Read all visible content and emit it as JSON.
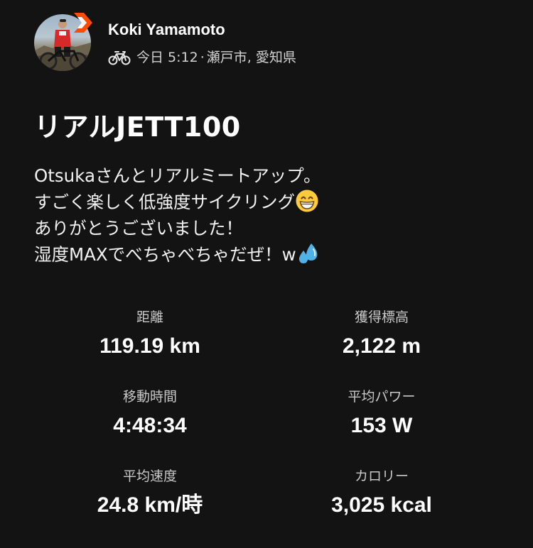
{
  "athlete": {
    "name": "Koki Yamamoto",
    "avatar_icon": "profile-photo",
    "badge_icon": "subscriber-chevron-icon"
  },
  "activity_meta": {
    "sport_icon": "bike-icon",
    "time": "今日 5:12",
    "separator": "·",
    "location": "瀬戸市, 愛知県"
  },
  "activity": {
    "title": "リアルJETT100",
    "description": [
      {
        "text": "Otsukaさんとリアルミートアップ。",
        "emoji": ""
      },
      {
        "text": "すごく楽しく低強度サイクリング",
        "emoji": "grinning-face-emoji"
      },
      {
        "text": "ありがとうございました！",
        "emoji": ""
      },
      {
        "text": "湿度MAXでべちゃべちゃだぜ！w",
        "emoji": "sweat-droplets-emoji"
      }
    ]
  },
  "stats": [
    {
      "label": "距離",
      "value": "119.19 km"
    },
    {
      "label": "獲得標高",
      "value": "2,122 m"
    },
    {
      "label": "移動時間",
      "value": "4:48:34"
    },
    {
      "label": "平均パワー",
      "value": "153 W"
    },
    {
      "label": "平均速度",
      "value": "24.8 km/時"
    },
    {
      "label": "カロリー",
      "value": "3,025 kcal"
    }
  ],
  "colors": {
    "background": "#131313",
    "brand_orange": "#fc4c02",
    "text_primary": "#ffffff",
    "text_secondary": "#c9c9c9"
  }
}
